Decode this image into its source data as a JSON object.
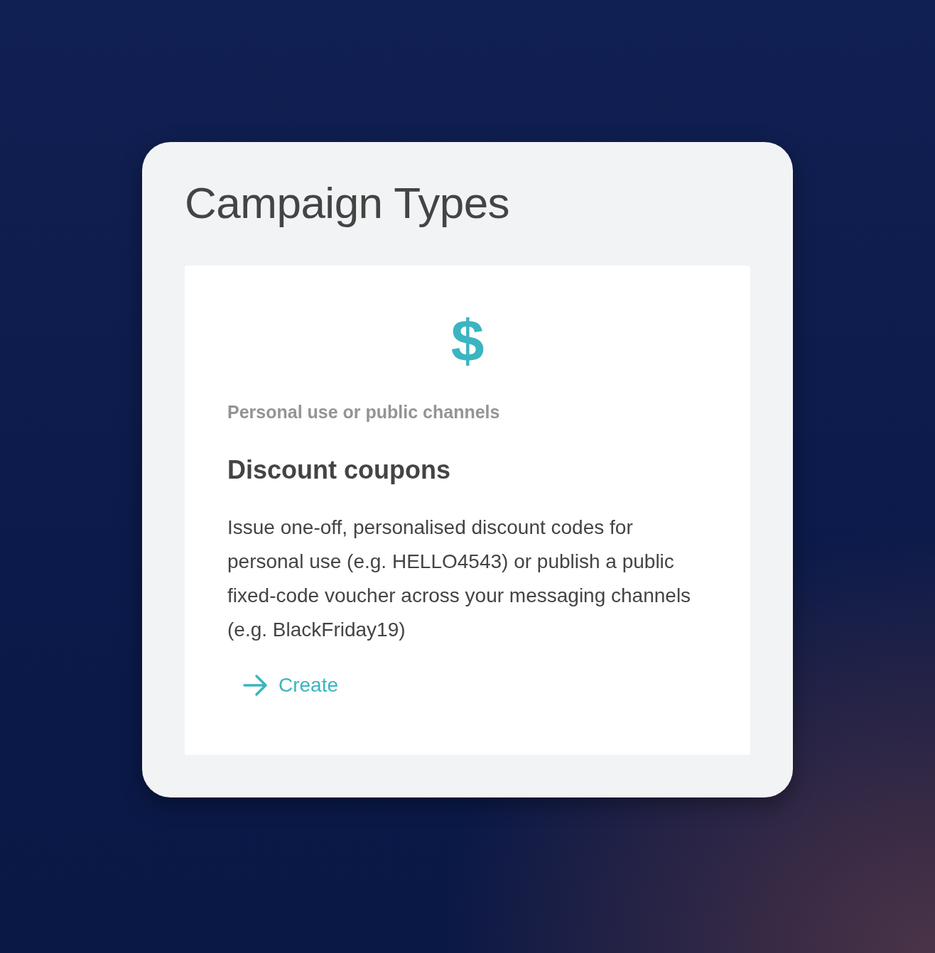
{
  "panel": {
    "title": "Campaign Types"
  },
  "card": {
    "icon": "$",
    "subtitle": "Personal use or public channels",
    "heading": "Discount coupons",
    "description": "Issue one-off, personalised discount codes for personal use (e.g. HELLO4543) or publish a public fixed-code voucher across your messaging channels (e.g. BlackFriday19)",
    "action": "Create"
  }
}
